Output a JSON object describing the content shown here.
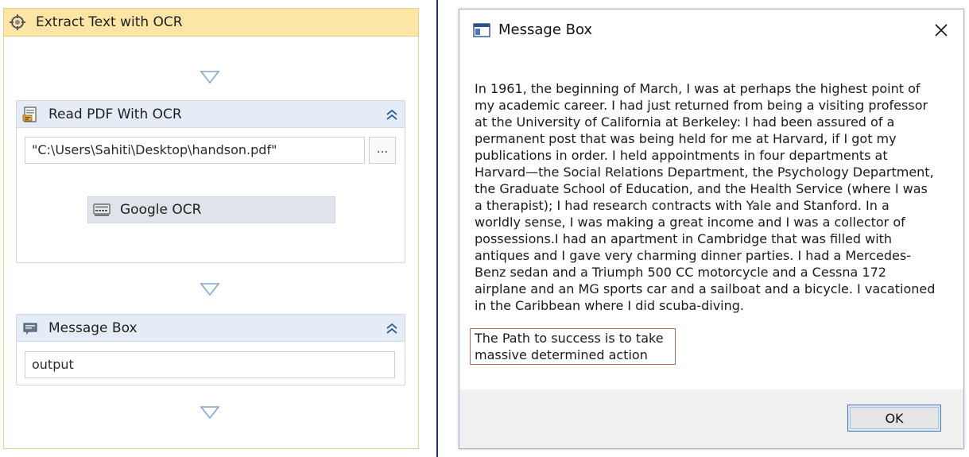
{
  "workflow": {
    "sequence_title": "Extract Text with OCR",
    "read_pdf": {
      "title": "Read PDF With OCR",
      "file_path": "\"C:\\Users\\Sahiti\\Desktop\\handson.pdf\"",
      "browse_label": "...",
      "ocr_engine": "Google OCR"
    },
    "message_box": {
      "title": "Message Box",
      "text_value": "output"
    }
  },
  "dialog": {
    "title": "Message Box",
    "message": "In 1961, the beginning of March, I was at perhaps the highest point of my academic career. I had just returned from being a visiting professor at the University of California at Berkeley: I had been assured of a permanent post that was being held for me at Harvard, if I got my publications in order. I held appointments in four departments at Harvard—the Social Relations Department, the Psychology Department, the Graduate School of Education, and the Health Service (where I was a therapist); I had research contracts with Yale and Stanford. In a worldly sense, I was making a great income and I was a collector of possessions.I had an apartment in Cambridge that was filled with antiques and I gave very charming dinner parties. I had a Mercedes-Benz sedan and a Triumph 500 CC motorcycle and a Cessna 172 airplane and an MG sports car and a sailboat and a bicycle. I vacationed in the Caribbean where I did scuba-diving.",
    "highlighted_text": "The Path to success is to take massive determined action",
    "ok_label": "OK"
  },
  "colors": {
    "sequence_header": "#fbe6a6",
    "activity_header": "#e5ecf5",
    "divider": "#1e2f6e",
    "highlight_border": "#b06a5a",
    "ok_focus_border": "#3a78c9"
  },
  "icons": {
    "sequence": "sequence-icon",
    "read_pdf": "pdf-ocr-icon",
    "google_ocr": "ocr-scanner-icon",
    "message_box": "message-box-icon",
    "dialog": "window-icon",
    "collapse": "double-chevron-up-icon",
    "close": "close-icon",
    "flow_arrow": "flow-arrow-icon"
  }
}
